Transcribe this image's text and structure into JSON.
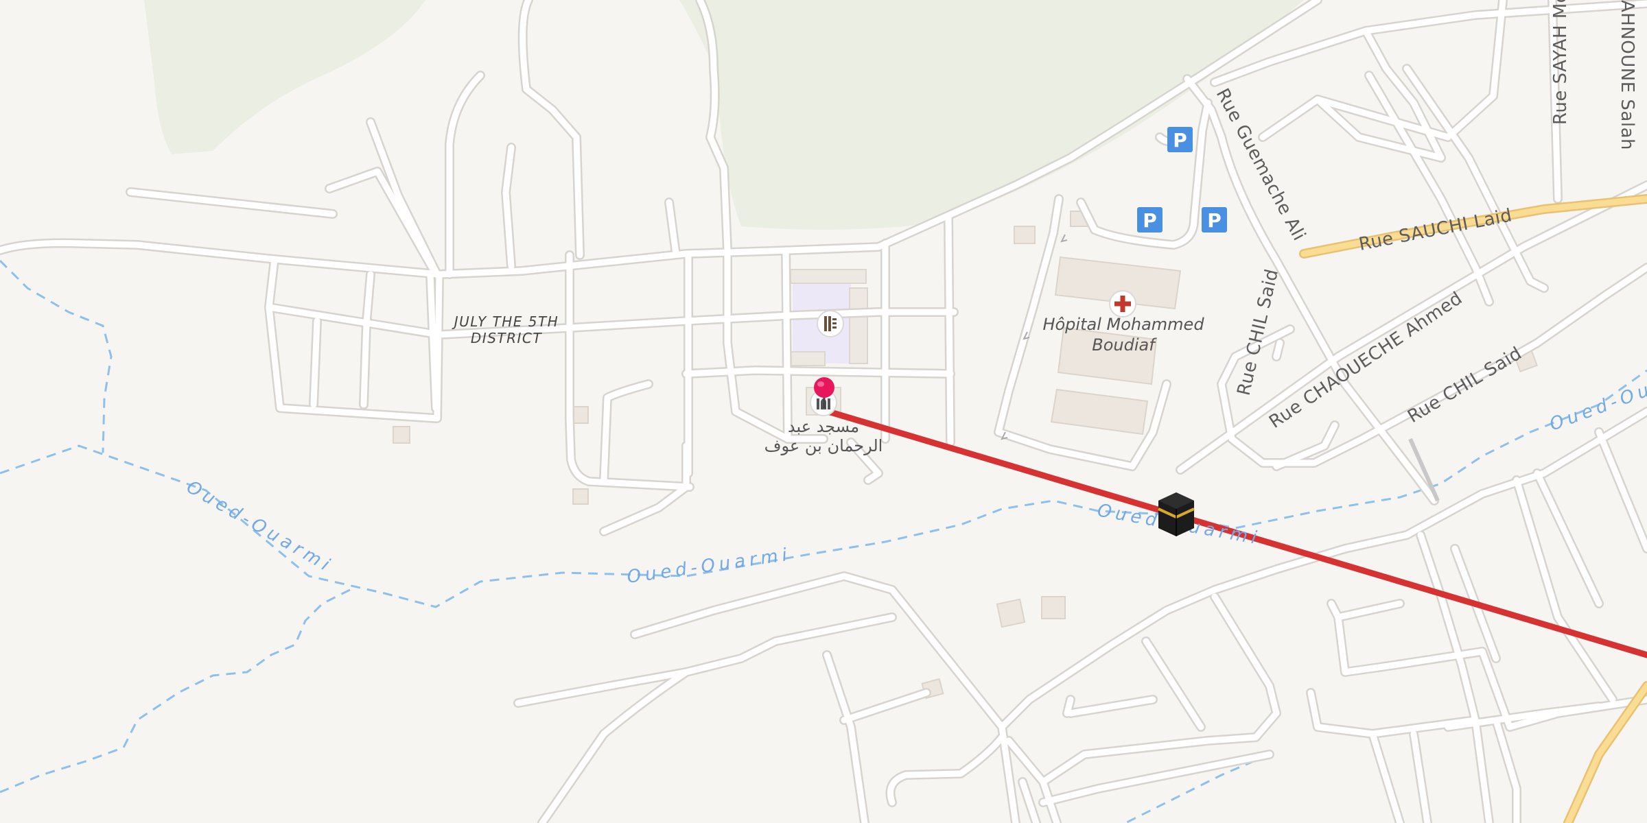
{
  "map": {
    "colors": {
      "land": "#f7f5f2",
      "park": "#eaeee3",
      "road": "#ffffff",
      "road_casing": "#d7d4cf",
      "primary_road": "#fbdc93",
      "primary_casing": "#e9c173",
      "water": "#8ec0ee",
      "route": "#d63232",
      "marker": "#e8175d",
      "parking": "#4a90e2",
      "hospital": "#c0392b"
    },
    "streets": {
      "guemache_ali": "Rue Guemache Ali",
      "sauchi_laid": "Rue SAUCHI Laid",
      "chil_said_1": "Rue CHIL Said",
      "chaoueche_ahmed": "Rue CHAOUECHE Ahmed",
      "chil_said_2": "Rue CHIL Said",
      "sayah_mo": "Rue SAYAH Moh",
      "ahnoune_salah": "AHNOUNE Salah"
    },
    "waterways": {
      "west": "Oued-Ouarmi",
      "center": "Oued-Ouarmi",
      "east": "Oued-Ouarmi",
      "far_east": "Oued-Ouarmi"
    },
    "places": {
      "district_line1": "JULY THE 5TH",
      "district_line2": "DISTRICT",
      "hospital_line1": "Hôpital Mohammed",
      "hospital_line2": "Boudiaf",
      "mosque_line1": "مسجد عبد",
      "mosque_line2": "الرحمان بن عوف"
    },
    "icons": {
      "parking_glyph": "P",
      "hospital_icon": "hospital-cross-icon",
      "school_icon": "school-icon",
      "mosque_icon": "mosque-icon",
      "kaaba_icon": "kaaba-icon",
      "pin_icon": "location-pin-icon"
    }
  }
}
